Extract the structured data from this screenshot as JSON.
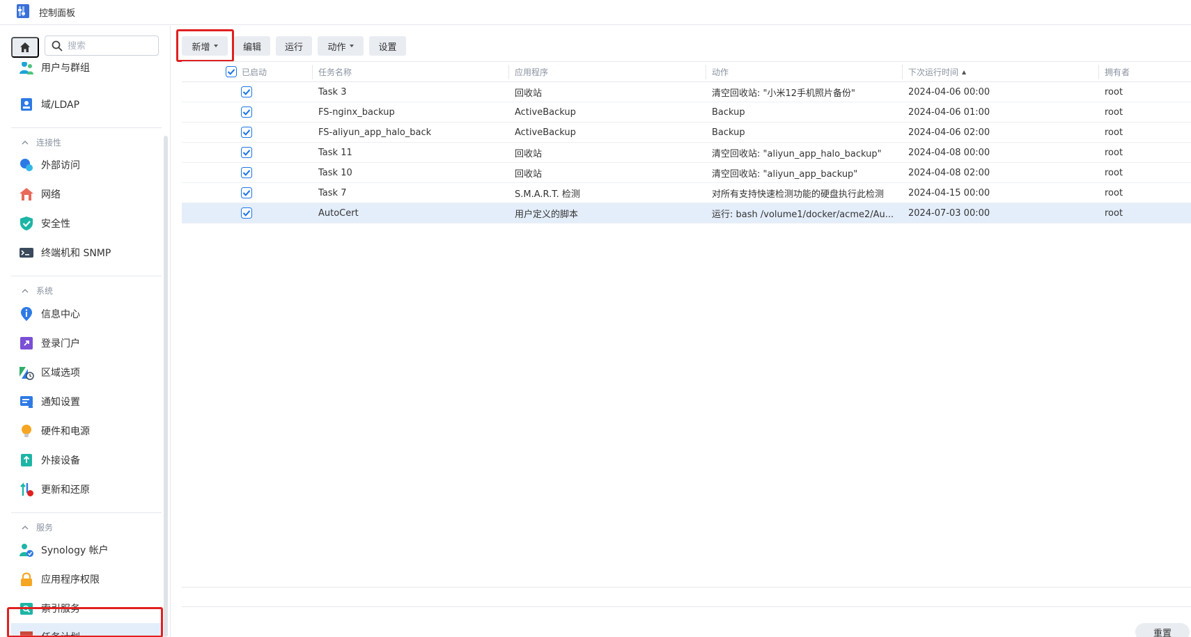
{
  "app": {
    "title": "控制面板"
  },
  "search": {
    "placeholder": "搜索"
  },
  "sidebar": {
    "items_top": [
      {
        "label": "用户与群组",
        "icon": "users-icon"
      },
      {
        "label": "域/LDAP",
        "icon": "ldap-icon"
      }
    ],
    "sections": [
      {
        "label": "连接性",
        "items": [
          {
            "label": "外部访问",
            "icon": "external-access-icon"
          },
          {
            "label": "网络",
            "icon": "network-icon"
          },
          {
            "label": "安全性",
            "icon": "shield-icon"
          },
          {
            "label": "终端机和 SNMP",
            "icon": "terminal-icon"
          }
        ]
      },
      {
        "label": "系统",
        "items": [
          {
            "label": "信息中心",
            "icon": "info-icon"
          },
          {
            "label": "登录门户",
            "icon": "login-portal-icon"
          },
          {
            "label": "区域选项",
            "icon": "region-icon"
          },
          {
            "label": "通知设置",
            "icon": "notification-icon"
          },
          {
            "label": "硬件和电源",
            "icon": "lightbulb-icon"
          },
          {
            "label": "外接设备",
            "icon": "external-device-icon"
          },
          {
            "label": "更新和还原",
            "icon": "update-icon"
          }
        ]
      },
      {
        "label": "服务",
        "items": [
          {
            "label": "Synology 帐户",
            "icon": "synology-account-icon"
          },
          {
            "label": "应用程序权限",
            "icon": "lock-icon"
          },
          {
            "label": "索引服务",
            "icon": "index-icon"
          },
          {
            "label": "任务计划",
            "icon": "calendar-icon",
            "active": true
          }
        ]
      }
    ]
  },
  "toolbar": {
    "create_label": "新增",
    "edit_label": "编辑",
    "run_label": "运行",
    "action_label": "动作",
    "settings_label": "设置"
  },
  "table": {
    "columns": {
      "enabled": "已启动",
      "name": "任务名称",
      "app": "应用程序",
      "action": "动作",
      "next_run": "下次运行时间",
      "owner": "拥有者"
    },
    "sort_indicator": "▲",
    "rows": [
      {
        "enabled": true,
        "name": "Task 3",
        "app": "回收站",
        "action": "清空回收站: \"小米12手机照片备份\"",
        "next_run": "2024-04-06 00:00",
        "owner": "root"
      },
      {
        "enabled": true,
        "name": "FS-nginx_backup",
        "app": "ActiveBackup",
        "action": "Backup",
        "next_run": "2024-04-06 01:00",
        "owner": "root"
      },
      {
        "enabled": true,
        "name": "FS-aliyun_app_halo_back",
        "app": "ActiveBackup",
        "action": "Backup",
        "next_run": "2024-04-06 02:00",
        "owner": "root"
      },
      {
        "enabled": true,
        "name": "Task 11",
        "app": "回收站",
        "action": "清空回收站: \"aliyun_app_halo_backup\"",
        "next_run": "2024-04-08 00:00",
        "owner": "root"
      },
      {
        "enabled": true,
        "name": "Task 10",
        "app": "回收站",
        "action": "清空回收站: \"aliyun_app_backup\"",
        "next_run": "2024-04-08 02:00",
        "owner": "root"
      },
      {
        "enabled": true,
        "name": "Task 7",
        "app": "S.M.A.R.T. 检测",
        "action": "对所有支持快速检测功能的硬盘执行此检测",
        "next_run": "2024-04-15 00:00",
        "owner": "root"
      },
      {
        "enabled": true,
        "name": "AutoCert",
        "app": "用户定义的脚本",
        "action": "运行: bash /volume1/docker/acme2/Au...",
        "next_run": "2024-07-03 00:00",
        "owner": "root",
        "selected": true
      }
    ]
  },
  "footer": {
    "reset_label": "重置"
  },
  "colors": {
    "accent": "#1a73e8",
    "highlight": "#e02020",
    "selected_row": "#e4eefb"
  }
}
